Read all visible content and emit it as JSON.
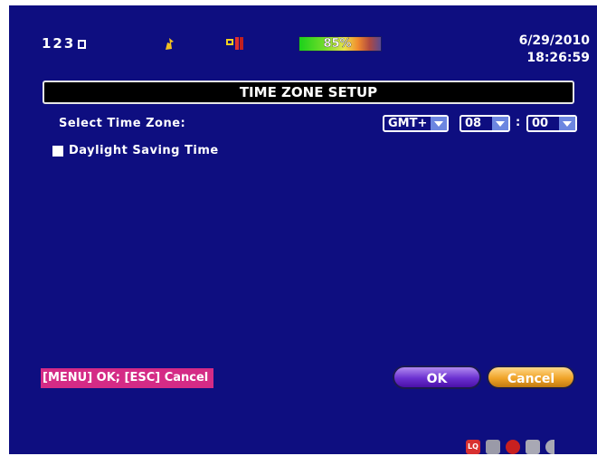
{
  "status_bar": {
    "channels": "123",
    "hdd_usage": "85%",
    "date": "6/29/2010",
    "time": "18:26:59"
  },
  "dialog": {
    "title": "TIME ZONE SETUP",
    "time_zone_label": "Select Time Zone:",
    "gmt_value": "GMT+",
    "hour_value": "08",
    "colon": ":",
    "minute_value": "00",
    "daylight_saving_label": "Daylight Saving Time",
    "daylight_saving_checked": false
  },
  "footer": {
    "hint": "[MENU] OK; [ESC] Cancel",
    "ok_label": "OK",
    "cancel_label": "Cancel"
  },
  "bottom_icons": {
    "lq_label": "LQ",
    "icons": [
      "lq-icon",
      "monitor-icon",
      "pin-icon",
      "bag-icon",
      "eye-icon"
    ]
  },
  "colors": {
    "background": "#0e0e80",
    "accent_ok": "#6a30d0",
    "accent_cancel": "#f0a428",
    "hint_bg": "#d42b86"
  }
}
